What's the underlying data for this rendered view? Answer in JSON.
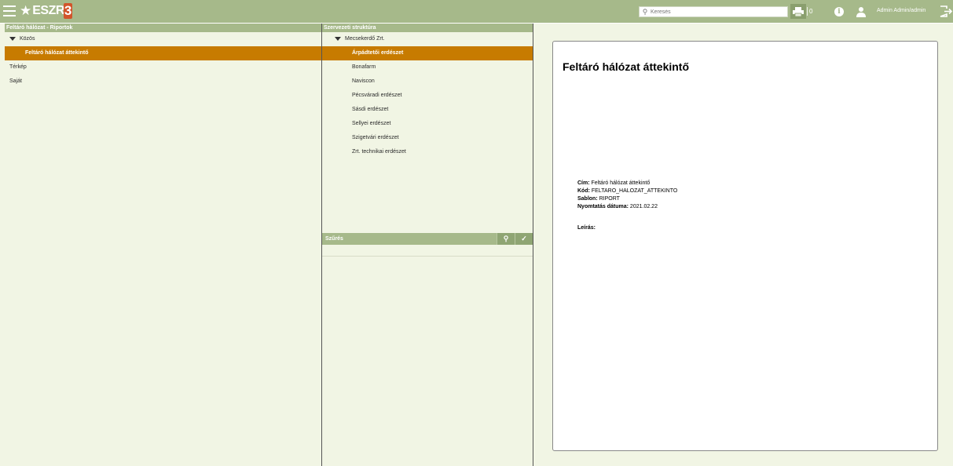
{
  "header": {
    "logo_text": "ESZR",
    "logo_suffix": "3",
    "search_placeholder": "Keresés",
    "print_count": "0",
    "user_name": "Admin Admin/admin"
  },
  "left_panel": {
    "title": "Feltáró hálózat - Riportok",
    "items": [
      {
        "label": "Közös",
        "expanded": true
      },
      {
        "label": "Feltáró hálózat áttekintő",
        "selected": true
      },
      {
        "label": "Térkép"
      },
      {
        "label": "Saját"
      }
    ]
  },
  "middle_panel": {
    "title": "Szervezeti struktúra",
    "root": "Mecsekerdő Zrt.",
    "items": [
      {
        "label": "Árpádtetői erdészet",
        "selected": true
      },
      {
        "label": "Bonafarm"
      },
      {
        "label": "Naviscon"
      },
      {
        "label": "Pécsváradi erdészet"
      },
      {
        "label": "Sásdi erdészet"
      },
      {
        "label": "Sellyei erdészet"
      },
      {
        "label": "Szigetvári erdészet"
      },
      {
        "label": "Zrt. technikai erdészet"
      }
    ],
    "filter_title": "Szűrés"
  },
  "preview": {
    "title": "Feltáró hálózat áttekintő",
    "cim_label": "Cím:",
    "cim_value": "Feltáró hálózat áttekintő",
    "kod_label": "Kód:",
    "kod_value": "FELTARO_HALOZAT_ATTEKINTO",
    "sablon_label": "Sablon:",
    "sablon_value": "RIPORT",
    "datum_label": "Nyomtatás dátuma:",
    "datum_value": "2021.02.22",
    "leiras_label": "Leírás:"
  },
  "colors": {
    "header_bg": "#a6b98a",
    "selected_bg": "#c77b00",
    "panel_bg": "#f1f5e4"
  }
}
